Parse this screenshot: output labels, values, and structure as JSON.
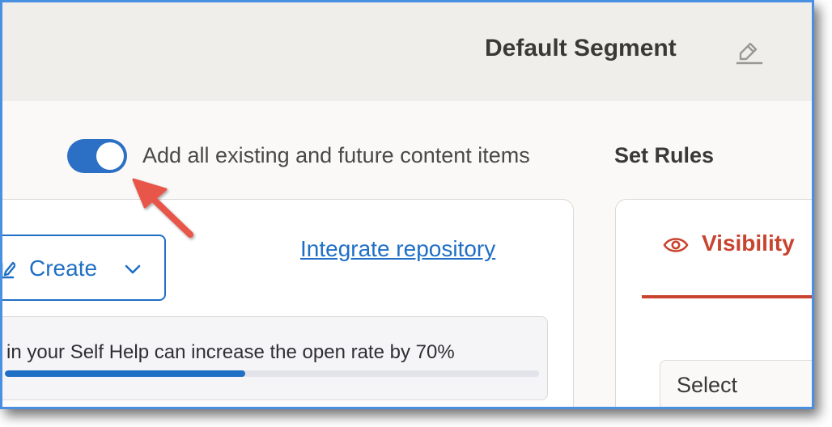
{
  "header": {
    "segment_title": "Default Segment",
    "edit_icon": "pencil-edit-icon"
  },
  "content_toggle": {
    "label": "Add all existing and future content items",
    "checked": true
  },
  "rules": {
    "heading": "Set Rules"
  },
  "repository": {
    "create_label": "Create",
    "create_icon": "edit-square-icon",
    "create_chevron_icon": "chevron-down-icon",
    "integrate_link": "Integrate repository",
    "tip_text": "in your Self Help can increase the open rate by 70%",
    "progress_fraction": 0.45
  },
  "visibility_tab": {
    "label": "Visibility",
    "icon": "eye-icon",
    "active": true
  },
  "select": {
    "value": "Select"
  },
  "colors": {
    "accent_blue": "#1f6fc5",
    "toggle_blue": "#2b70c4",
    "visibility_red": "#c8442f",
    "annotation_arrow": "#e8554a",
    "frame_border": "#4a90e2"
  }
}
